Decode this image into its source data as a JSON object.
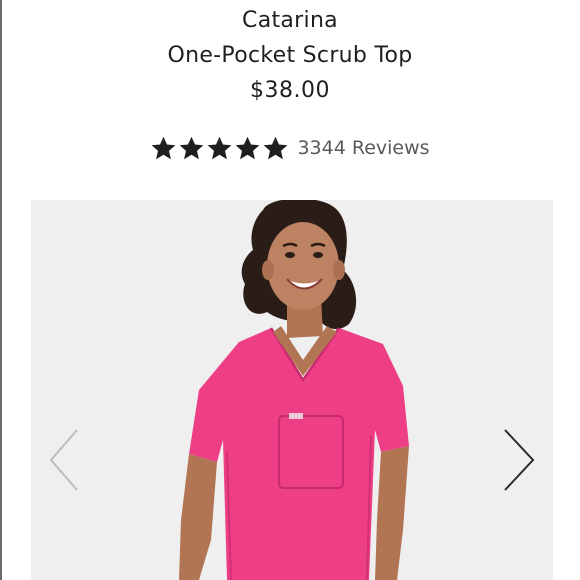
{
  "product": {
    "brand": "Catarina",
    "name": "One-Pocket Scrub Top",
    "price": "$38.00",
    "rating": 5,
    "rating_max": 5,
    "reviews_text": "3344 Reviews"
  },
  "gallery": {
    "background_color": "#efefef",
    "garment_color": "#ee3f86",
    "prev_icon": "chevron-left-icon",
    "next_icon": "chevron-right-icon"
  }
}
